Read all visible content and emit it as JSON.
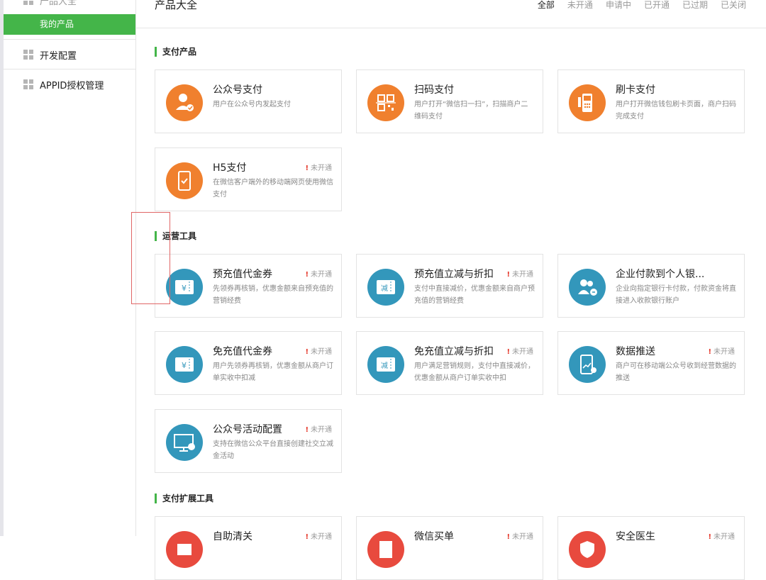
{
  "sidebar": {
    "items": [
      {
        "label": "产品大全",
        "icon": "grid-icon"
      },
      {
        "label": "我的产品",
        "active": true
      },
      {
        "label": "开发配置",
        "icon": "grid-icon"
      },
      {
        "label": "APPID授权管理",
        "icon": "grid-icon"
      }
    ]
  },
  "header": {
    "title": "产品大全",
    "filters": [
      "全部",
      "未开通",
      "申请中",
      "已开通",
      "已过期",
      "已关闭"
    ]
  },
  "sections": [
    {
      "title": "支付产品",
      "cards": [
        {
          "title": "公众号支付",
          "desc": "用户在公众号内发起支付",
          "status": "",
          "color": "#f0802e",
          "icon": "user-check-icon"
        },
        {
          "title": "扫码支付",
          "desc": "用户打开“微信扫一扫”，扫描商户二维码支付",
          "status": "",
          "color": "#f0802e",
          "icon": "qrcode-icon"
        },
        {
          "title": "刷卡支付",
          "desc": "用户打开微信钱包刷卡页面，商户扫码完成支付",
          "status": "",
          "color": "#f0802e",
          "icon": "card-terminal-icon"
        },
        {
          "title": "H5支付",
          "desc": "在微信客户端外的移动端网页使用微信支付",
          "status": "未开通",
          "color": "#f0802e",
          "icon": "phone-check-icon"
        }
      ]
    },
    {
      "title": "运营工具",
      "cards": [
        {
          "title": "预充值代金券",
          "desc": "先领券再核销，优惠金额来自预充值的营销经费",
          "status": "未开通",
          "color": "#3397bb",
          "icon": "yen-coupon-icon"
        },
        {
          "title": "预充值立减与折扣",
          "desc": "支付中直接减价，优惠金额来自商户预充值的营销经费",
          "status": "未开通",
          "color": "#3397bb",
          "icon": "discount-coupon-icon"
        },
        {
          "title": "企业付款到个人银...",
          "desc": "企业向指定银行卡付款，付款资金将直接进入收款银行账户",
          "status": "",
          "color": "#3397bb",
          "icon": "users-pay-icon"
        },
        {
          "title": "免充值代金券",
          "desc": "用户先领券再核销，优惠金额从商户订单实收中扣减",
          "status": "未开通",
          "color": "#3397bb",
          "icon": "yen-coupon-icon"
        },
        {
          "title": "免充值立减与折扣",
          "desc": "用户满足营销规则，支付中直接减价，优惠金额从商户订单实收中扣",
          "status": "未开通",
          "color": "#3397bb",
          "icon": "discount-coupon-icon"
        },
        {
          "title": "数据推送",
          "desc": "商户可在移动端公众号收到经营数据的推送",
          "status": "未开通",
          "color": "#3397bb",
          "icon": "phone-chart-icon"
        },
        {
          "title": "公众号活动配置",
          "desc": "支持在微信公众平台直接创建社交立减金活动",
          "status": "未开通",
          "color": "#3397bb",
          "icon": "monitor-settings-icon"
        }
      ]
    },
    {
      "title": "支付扩展工具",
      "cards": [
        {
          "title": "自助清关",
          "desc": "",
          "status": "未开通",
          "color": "#e84a3e",
          "icon": "customs-icon"
        },
        {
          "title": "微信买单",
          "desc": "",
          "status": "未开通",
          "color": "#e84a3e",
          "icon": "bill-icon"
        },
        {
          "title": "安全医生",
          "desc": "",
          "status": "未开通",
          "color": "#e84a3e",
          "icon": "doctor-icon"
        }
      ]
    }
  ],
  "status_mark": "!"
}
